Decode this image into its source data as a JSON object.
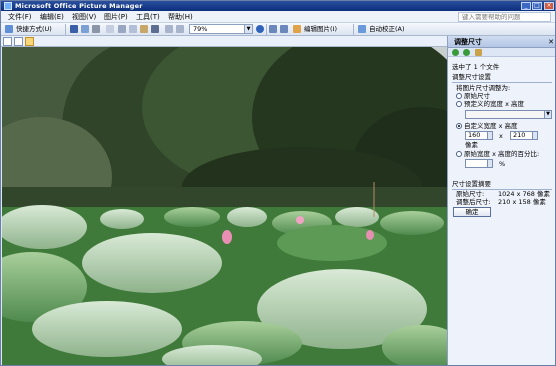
{
  "window": {
    "title": "Microsoft Office Picture Manager",
    "minimize": "_",
    "maximize": "□",
    "close": "×"
  },
  "menu": {
    "items": [
      "文件(F)",
      "编辑(E)",
      "视图(V)",
      "图片(P)",
      "工具(T)",
      "帮助(H)"
    ],
    "help_search_placeholder": "键入需要帮助的问题"
  },
  "toolbar": {
    "shortcuts_label": "快捷方式(U)",
    "zoom_value": "79%",
    "edit_pictures_label": "编辑图片(I)",
    "auto_correct_label": "自动校正(A)"
  },
  "pane": {
    "title": "调整尺寸",
    "selected_info": "选中了 1 个文件",
    "size_settings_heading": "调整尺寸设置",
    "resize_to_label": "将图片尺寸调整为:",
    "options": {
      "original": "原始尺寸",
      "predefined": "预定义的宽度 x 高度",
      "custom": "自定义宽度 x 高度",
      "percent": "原始宽度 x 高度的百分比:"
    },
    "custom_width": "160",
    "custom_height": "210",
    "times": "x",
    "pixels_label": "像素",
    "percent_symbol": "%",
    "summary_heading": "尺寸设置摘要",
    "original_size_label": "原始尺寸:",
    "original_size_value": "1024 x 768 像素",
    "new_size_label": "调整后尺寸:",
    "new_size_value": "210 x 158 像素",
    "ok_label": "确定"
  },
  "colors": {
    "titlebar": "#0b2f7d",
    "accent": "#f8d67a"
  }
}
